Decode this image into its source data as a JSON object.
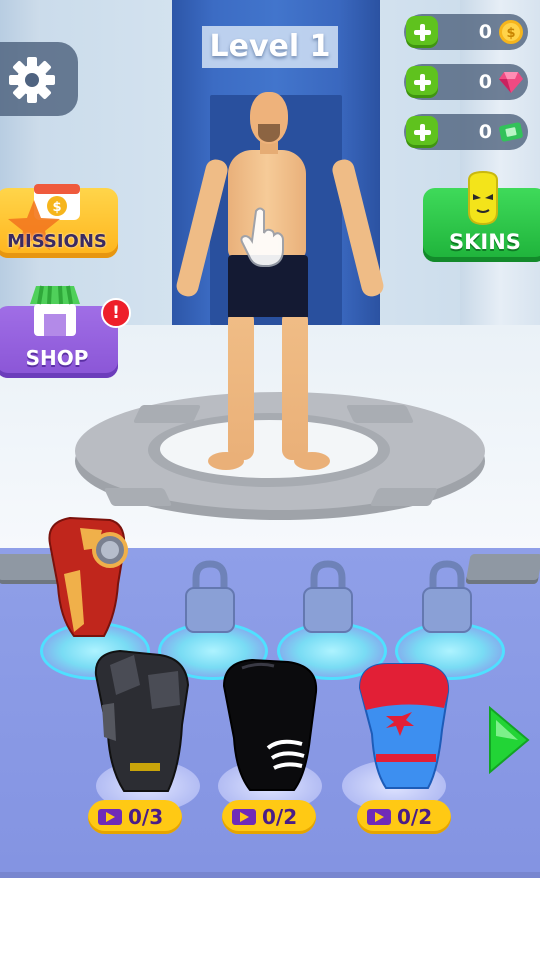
{
  "hud": {
    "level_title": "Level 1",
    "currencies": [
      {
        "name": "coins",
        "value": "0",
        "icon": "gold-coin-icon"
      },
      {
        "name": "gems",
        "value": "0",
        "icon": "pink-gem-icon"
      },
      {
        "name": "tickets",
        "value": "0",
        "icon": "green-ticket-icon"
      }
    ]
  },
  "side_buttons": {
    "missions_label": "MISSIONS",
    "shop_label": "SHOP",
    "shop_alert": "!",
    "skins_label": "SKINS"
  },
  "wardrobe": {
    "items": [
      {
        "name": "red-gold-armor",
        "state": "unlocked"
      },
      {
        "name": "locked-slot-1",
        "state": "locked"
      },
      {
        "name": "locked-slot-2",
        "state": "locked"
      },
      {
        "name": "locked-slot-3",
        "state": "locked"
      },
      {
        "name": "black-armor",
        "state": "ad-unlock",
        "progress": "0/3"
      },
      {
        "name": "black-symbiote-suit",
        "state": "ad-unlock",
        "progress": "0/2"
      },
      {
        "name": "red-blue-spider-suit",
        "state": "ad-unlock",
        "progress": "0/2"
      }
    ]
  },
  "colors": {
    "panel": "#8f9fe8",
    "skins_button": "#1eb23a",
    "shop_button": "#8a55d6",
    "missions_button": "#ffb41c",
    "progress_pill": "#ffc914"
  }
}
